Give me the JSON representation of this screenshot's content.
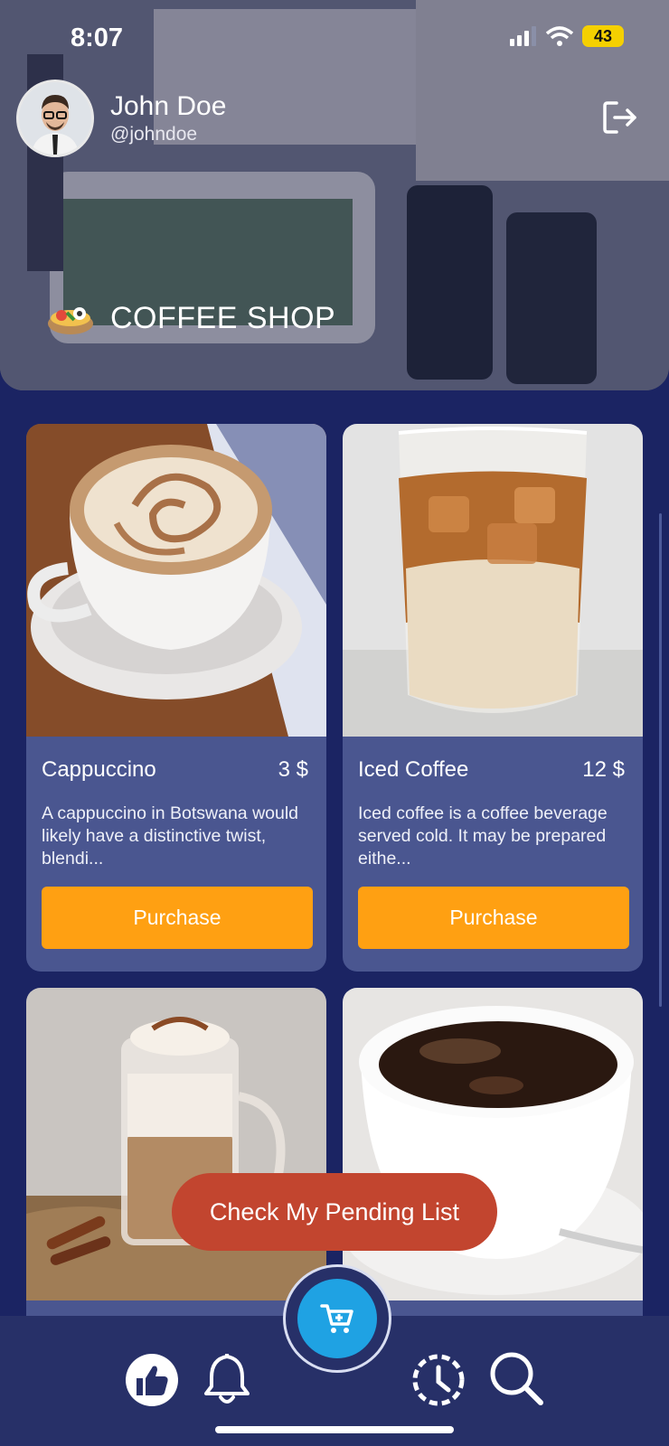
{
  "status_bar": {
    "time": "8:07",
    "battery": "43"
  },
  "header": {
    "user_name": "John Doe",
    "user_handle": "@johndoe",
    "shop_title": "COFFEE SHOP"
  },
  "products": [
    {
      "name": "Cappuccino",
      "price": "3 $",
      "description": "A cappuccino in Botswana would likely have a distinctive twist, blendi...",
      "button": "Purchase"
    },
    {
      "name": "Iced Coffee",
      "price": "12 $",
      "description": "Iced coffee is a coffee beverage served cold. It may be prepared eithe...",
      "button": "Purchase"
    }
  ],
  "pending_button": "Check My Pending List",
  "nav": {
    "icons": [
      "thumbs-up-icon",
      "bell-icon",
      "cart-icon",
      "history-icon",
      "search-icon"
    ]
  },
  "colors": {
    "background": "#1b2463",
    "card": "#4a5690",
    "purchase": "#ffa012",
    "pending": "#c2452f",
    "cart": "#1fa2e3",
    "nav": "#273068"
  }
}
